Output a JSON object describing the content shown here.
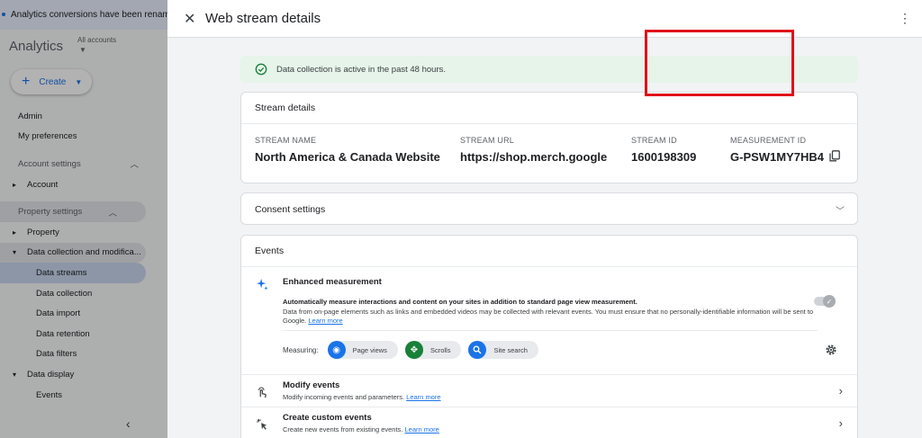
{
  "background": {
    "banner_text": "Analytics conversions have been renamed",
    "app_title": "Analytics",
    "accounts_label": "All accounts",
    "create_label": "Create",
    "nav": {
      "admin": "Admin",
      "preferences": "My preferences",
      "account_settings": "Account settings",
      "account": "Account",
      "property_settings": "Property settings",
      "property": "Property",
      "data_collection_mod": "Data collection and modifica...",
      "data_streams": "Data streams",
      "data_collection": "Data collection",
      "data_import": "Data import",
      "data_retention": "Data retention",
      "data_filters": "Data filters",
      "data_display": "Data display",
      "events": "Events"
    }
  },
  "drawer": {
    "title": "Web stream details",
    "status_text": "Data collection is active in the past 48 hours.",
    "stream_details": {
      "heading": "Stream details",
      "stream_name_label": "STREAM NAME",
      "stream_name": "North America & Canada Website",
      "stream_url_label": "STREAM URL",
      "stream_url": "https://shop.merch.google",
      "stream_id_label": "STREAM ID",
      "stream_id": "1600198309",
      "measurement_id_label": "MEASUREMENT ID",
      "measurement_id": "G-PSW1MY7HB4"
    },
    "consent_heading": "Consent settings",
    "events": {
      "heading": "Events",
      "enhanced_title": "Enhanced measurement",
      "enhanced_desc_bold": "Automatically measure interactions and content on your sites in addition to standard page view measurement.",
      "enhanced_desc": "Data from on-page elements such as links and embedded videos may be collected with relevant events. You must ensure that no personally-identifiable information will be sent to Google.",
      "learn_more": "Learn more",
      "measuring_label": "Measuring:",
      "chips": [
        "Page views",
        "Scrolls",
        "Site search"
      ],
      "modify_title": "Modify events",
      "modify_desc": "Modify incoming events and parameters.",
      "custom_title": "Create custom events",
      "custom_desc": "Create new events from existing events."
    }
  },
  "colors": {
    "accent": "#1a73e8",
    "status_bg": "#e6f4ea",
    "highlight_box": "#e0101a"
  }
}
